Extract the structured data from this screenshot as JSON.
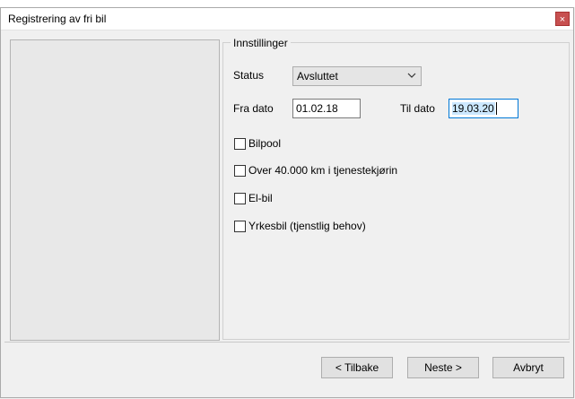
{
  "window": {
    "title": "Registrering av fri bil",
    "close_glyph": "×"
  },
  "settings": {
    "group_label": "Innstillinger",
    "status_label": "Status",
    "status_value": "Avsluttet",
    "from_label": "Fra dato",
    "from_value": "01.02.18",
    "to_label": "Til dato",
    "to_value": "19.03.20"
  },
  "checkboxes": [
    {
      "label": "Bilpool",
      "checked": false
    },
    {
      "label": "Over 40.000 km i tjenestekjøring",
      "checked": false
    },
    {
      "label": "El-bil",
      "checked": false
    },
    {
      "label": "Yrkesbil (tjenstlig behov)",
      "checked": false
    }
  ],
  "buttons": {
    "back": "< Tilbake",
    "next": "Neste >",
    "cancel": "Avbryt"
  },
  "icons": {
    "dropdown": "chevron-down-icon",
    "close": "close-icon"
  },
  "colors": {
    "close_button": "#c75050",
    "focus_border": "#0078d7",
    "selection": "#cce8ff"
  }
}
